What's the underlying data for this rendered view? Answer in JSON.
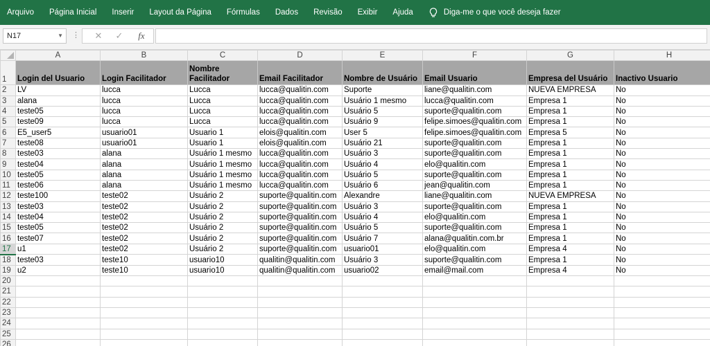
{
  "ribbon": {
    "tabs": [
      "Arquivo",
      "Página Inicial",
      "Inserir",
      "Layout da Página",
      "Fórmulas",
      "Dados",
      "Revisão",
      "Exibir",
      "Ajuda"
    ],
    "tell_me": "Diga-me o que você deseja fazer",
    "accent": "#217346"
  },
  "formula_bar": {
    "name_box": "N17",
    "formula": ""
  },
  "sheet": {
    "columns": [
      "A",
      "B",
      "C",
      "D",
      "E",
      "F",
      "G",
      "H"
    ],
    "headers": [
      "Login del Usuario",
      "Login Facilitador",
      "Nombre Facilitador",
      "Email Facilitador",
      "Nombre de Usuário",
      "Email Usuario",
      "Empresa del Usuário",
      "Inactivo Usuario"
    ],
    "rows": [
      [
        "LV",
        "lucca",
        "Lucca",
        "lucca@qualitin.com",
        "Suporte",
        "liane@qualitin.com",
        "NUEVA EMPRESA",
        "No"
      ],
      [
        "alana",
        "lucca",
        "Lucca",
        "lucca@qualitin.com",
        "Usuário 1 mesmo",
        "lucca@qualitin.com",
        "Empresa 1",
        "No"
      ],
      [
        "teste05",
        "lucca",
        "Lucca",
        "lucca@qualitin.com",
        "Usuário 5",
        "suporte@qualitin.com",
        "Empresa 1",
        "No"
      ],
      [
        "teste09",
        "lucca",
        "Lucca",
        "lucca@qualitin.com",
        "Usuário 9",
        "felipe.simoes@qualitin.com",
        "Empresa 1",
        "No"
      ],
      [
        "E5_user5",
        "usuario01",
        "Usuario 1",
        "elois@qualitin.com",
        "User 5",
        "felipe.simoes@qualitin.com",
        "Empresa 5",
        "No"
      ],
      [
        "teste08",
        "usuario01",
        "Usuario 1",
        "elois@qualitin.com",
        "Usuário 21",
        "suporte@qualitin.com",
        "Empresa 1",
        "No"
      ],
      [
        "teste03",
        "alana",
        "Usuário 1 mesmo",
        "lucca@qualitin.com",
        "Usuário 3",
        "suporte@qualitin.com",
        "Empresa 1",
        "No"
      ],
      [
        "teste04",
        "alana",
        "Usuário 1 mesmo",
        "lucca@qualitin.com",
        "Usuário 4",
        "elo@qualitin.com",
        "Empresa 1",
        "No"
      ],
      [
        "teste05",
        "alana",
        "Usuário 1 mesmo",
        "lucca@qualitin.com",
        "Usuário 5",
        "suporte@qualitin.com",
        "Empresa 1",
        "No"
      ],
      [
        "teste06",
        "alana",
        "Usuário 1 mesmo",
        "lucca@qualitin.com",
        "Usuário 6",
        "jean@qualitin.com",
        "Empresa 1",
        "No"
      ],
      [
        "teste100",
        "teste02",
        "Usuário 2",
        "suporte@qualitin.com",
        "Alexandre",
        "liane@qualitin.com",
        "NUEVA EMPRESA",
        "No"
      ],
      [
        "teste03",
        "teste02",
        "Usuário 2",
        "suporte@qualitin.com",
        "Usuário 3",
        "suporte@qualitin.com",
        "Empresa 1",
        "No"
      ],
      [
        "teste04",
        "teste02",
        "Usuário 2",
        "suporte@qualitin.com",
        "Usuário 4",
        "elo@qualitin.com",
        "Empresa 1",
        "No"
      ],
      [
        "teste05",
        "teste02",
        "Usuário 2",
        "suporte@qualitin.com",
        "Usuário 5",
        "suporte@qualitin.com",
        "Empresa 1",
        "No"
      ],
      [
        "teste07",
        "teste02",
        "Usuário 2",
        "suporte@qualitin.com",
        "Usuário 7",
        "alana@qualitin.com.br",
        "Empresa 1",
        "No"
      ],
      [
        "u1",
        "teste02",
        "Usuário 2",
        "suporte@qualitin.com",
        "usuario01",
        "elo@qualitin.com",
        "Empresa 4",
        "No"
      ],
      [
        "teste03",
        "teste10",
        "usuario10",
        "qualitin@qualitin.com",
        "Usuário 3",
        "suporte@qualitin.com",
        "Empresa 1",
        "No"
      ],
      [
        "u2",
        "teste10",
        "usuario10",
        "qualitin@qualitin.com",
        "usuario02",
        "email@mail.com",
        "Empresa 4",
        "No"
      ]
    ],
    "row_numbers": [
      "1",
      "2",
      "3",
      "4",
      "5",
      "6",
      "7",
      "8",
      "9",
      "10",
      "11",
      "12",
      "13",
      "14",
      "15",
      "16",
      "17",
      "18",
      "19",
      "20",
      "21",
      "22",
      "23",
      "24",
      "25",
      "26"
    ],
    "selected_row": "17"
  }
}
